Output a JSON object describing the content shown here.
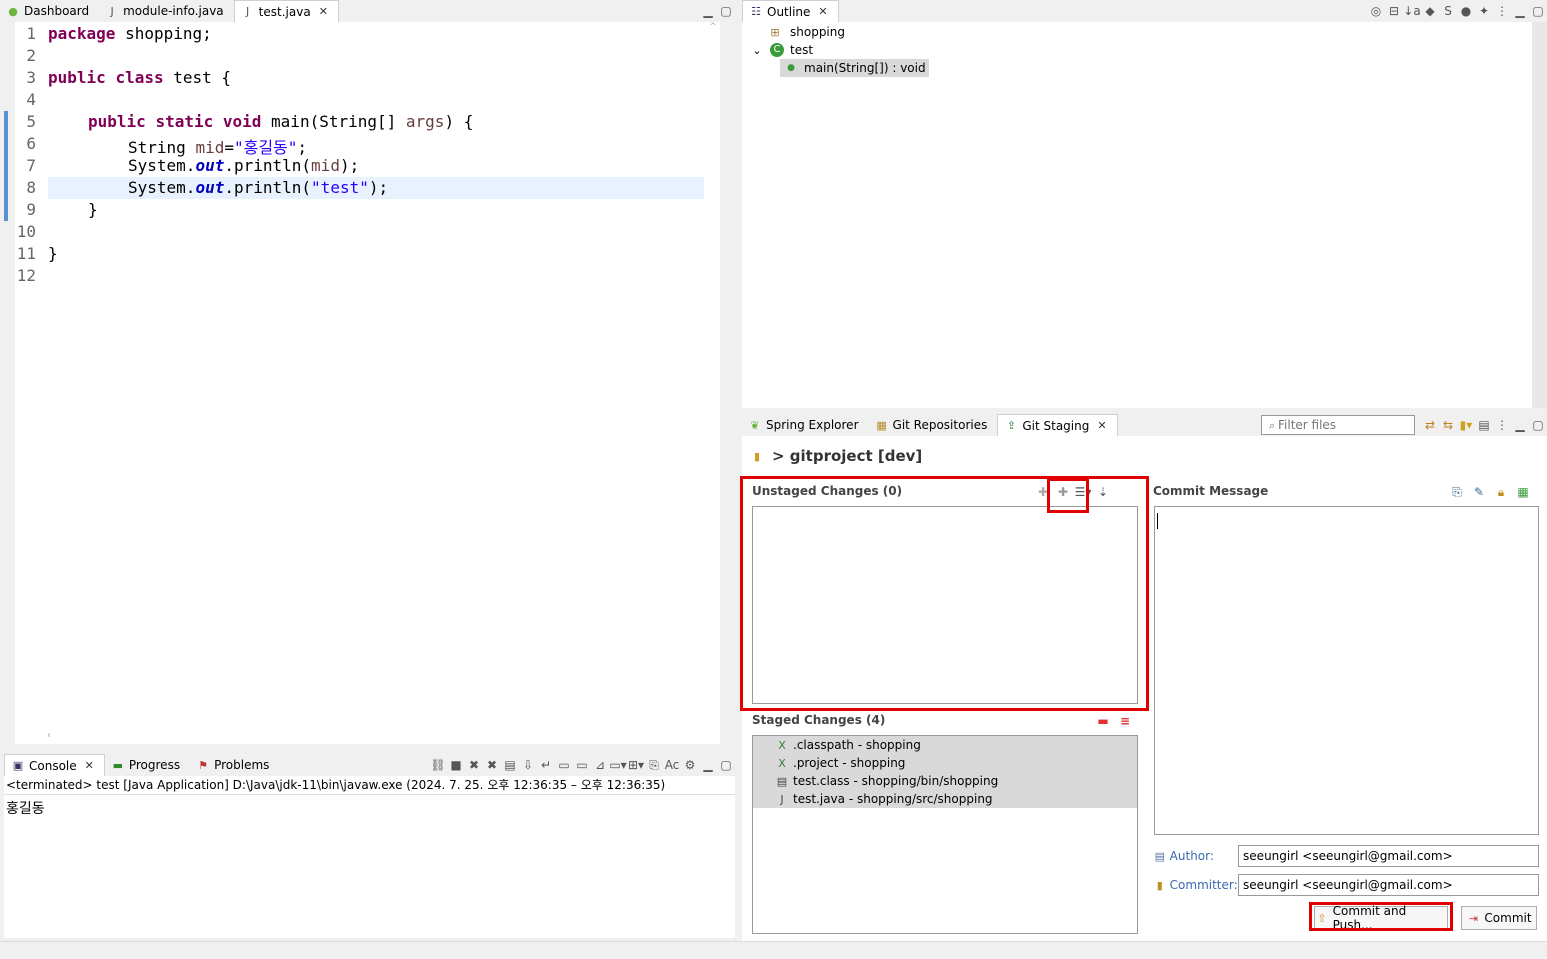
{
  "editor_tabs": [
    {
      "label": "Dashboard",
      "icon": "spring-icon"
    },
    {
      "label": "module-info.java",
      "icon": "java-file-icon"
    },
    {
      "label": "test.java",
      "icon": "java-file-icon"
    }
  ],
  "editor": {
    "line_numbers": [
      "1",
      "2",
      "3",
      "4",
      "5",
      "6",
      "7",
      "8",
      "9",
      "10",
      "11",
      "12"
    ],
    "lines": [
      {
        "kw1": "package",
        "rest": " shopping;"
      },
      {},
      {
        "kw1": "public",
        "kw2": "class",
        "rest": " test {"
      },
      {},
      {
        "kw1": "public",
        "kw2": "static",
        "kw3": "void",
        "rest": " main(String[] ",
        "var": "args",
        "rest2": ") {"
      },
      {
        "pre": "String ",
        "var": "mid",
        "eq": "=",
        "str": "\"홍길동\"",
        "end": ";"
      },
      {
        "pre": "System.",
        "fld": "out",
        "mid": ".println(",
        "var": "mid",
        "end": ");"
      },
      {
        "pre": "System.",
        "fld": "out",
        "mid": ".println(",
        "str": "\"test\"",
        "end": ");"
      },
      {
        "rest": "}"
      },
      {},
      {
        "rest": "}"
      },
      {}
    ]
  },
  "outline": {
    "tab_label": "Outline",
    "items": [
      {
        "label": "shopping",
        "icon": "package-icon"
      },
      {
        "label": "test",
        "icon": "class-icon"
      },
      {
        "label": "main(String[]) : void",
        "icon": "method-icon"
      }
    ]
  },
  "console": {
    "tabs": [
      "Console",
      "Progress",
      "Problems"
    ],
    "status": "<terminated> test [Java Application] D:\\Java\\jdk-11\\bin\\javaw.exe  (2024. 7. 25. 오후 12:36:35 – 오후 12:36:35)",
    "output": "홍길동"
  },
  "git": {
    "tabs": [
      "Spring Explorer",
      "Git Repositories",
      "Git Staging"
    ],
    "filter_placeholder": "Filter files",
    "repo": "> gitproject [dev]",
    "unstaged_title": "Unstaged Changes (0)",
    "staged_title": "Staged Changes (4)",
    "staged_files": [
      {
        "label": ".classpath - shopping",
        "icon": "xml-file-icon"
      },
      {
        "label": ".project - shopping",
        "icon": "xml-file-icon"
      },
      {
        "label": "test.class - shopping/bin/shopping",
        "icon": "class-file-icon"
      },
      {
        "label": "test.java - shopping/src/shopping",
        "icon": "java-file-icon"
      }
    ],
    "commit_message_title": "Commit Message",
    "author_label": "Author:",
    "author_value": "seeungirl <seeungirl@gmail.com>",
    "committer_label": "Committer:",
    "committer_value": "seeungirl <seeungirl@gmail.com>",
    "commit_push_label": "Commit and Push...",
    "commit_label": "Commit"
  },
  "colors": {
    "highlight": "#e00000",
    "keyword": "#7f0055",
    "string": "#2a00ff",
    "field": "#0000c0"
  }
}
